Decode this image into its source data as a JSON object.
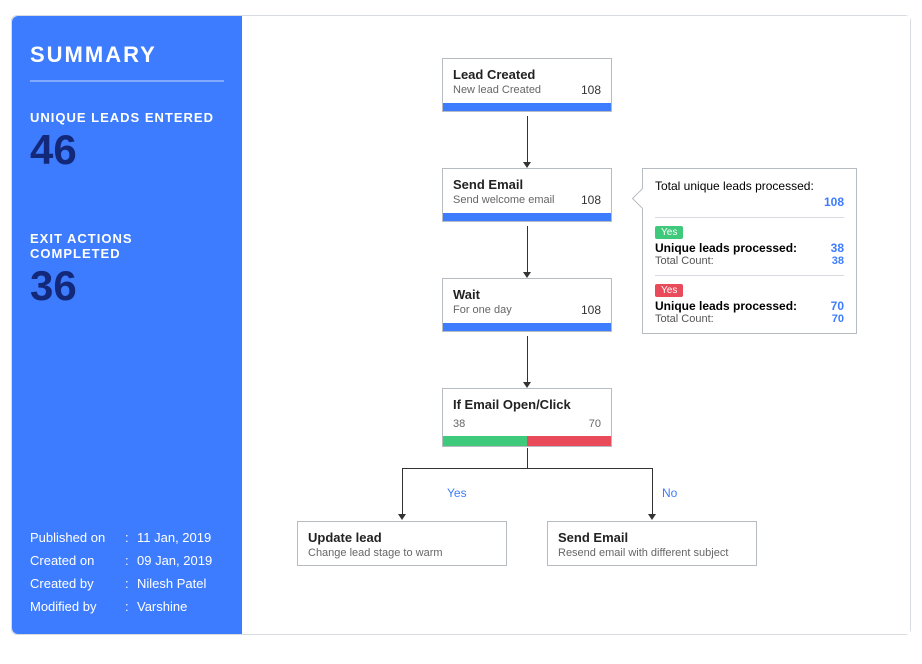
{
  "sidebar": {
    "title": "SUMMARY",
    "stat1_label": "UNIQUE LEADS ENTERED",
    "stat1_value": "46",
    "stat2_label": "EXIT ACTIONS COMPLETED",
    "stat2_value": "36",
    "meta": [
      {
        "key": "Published on",
        "val": "11 Jan, 2019"
      },
      {
        "key": "Created on",
        "val": "09 Jan, 2019"
      },
      {
        "key": "Created by",
        "val": "Nilesh Patel"
      },
      {
        "key": "Modified by",
        "val": "Varshine"
      }
    ]
  },
  "nodes": {
    "lead_created": {
      "title": "Lead Created",
      "sub": "New lead Created",
      "count": "108"
    },
    "send_email": {
      "title": "Send Email",
      "sub": "Send welcome email",
      "count": "108"
    },
    "wait": {
      "title": "Wait",
      "sub": "For one day",
      "count": "108"
    },
    "condition": {
      "title": "If Email Open/Click",
      "yes_count": "38",
      "no_count": "70"
    },
    "update_lead": {
      "title": "Update lead",
      "sub": "Change lead stage to warm"
    },
    "resend_email": {
      "title": "Send Email",
      "sub": "Resend email with different subject"
    }
  },
  "branch_labels": {
    "yes": "Yes",
    "no": "No"
  },
  "popover": {
    "total_label": "Total unique leads processed:",
    "total_value": "108",
    "yes_tag": "Yes",
    "yes_line1_label": "Unique leads processed:",
    "yes_line1_value": "38",
    "yes_line2_label": "Total Count:",
    "yes_line2_value": "38",
    "no_tag": "Yes",
    "no_line1_label": "Unique leads processed:",
    "no_line1_value": "70",
    "no_line2_label": "Total Count:",
    "no_line2_value": "70"
  }
}
